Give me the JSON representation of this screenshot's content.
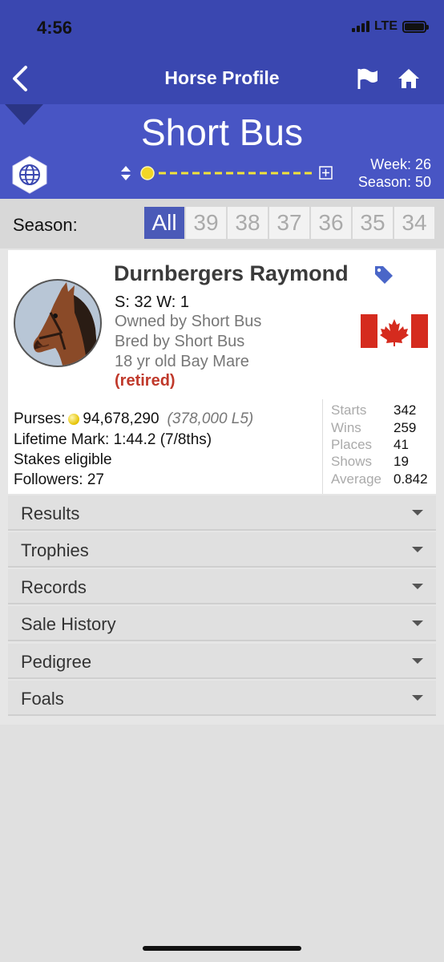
{
  "status": {
    "time": "4:56",
    "network": "LTE"
  },
  "nav": {
    "title": "Horse Profile"
  },
  "header": {
    "stable_name": "Short Bus",
    "week_label": "Week: 26",
    "season_label": "Season: 50"
  },
  "seasons": {
    "label": "Season:",
    "tabs": [
      "All",
      "39",
      "38",
      "37",
      "36",
      "35",
      "34"
    ],
    "selected": "All"
  },
  "horse": {
    "name": "Durnbergers Raymond",
    "sw": "S: 32 W: 1",
    "owned_by": "Owned by Short Bus",
    "bred_by": "Bred by Short Bus",
    "description": "18 yr old Bay Mare",
    "status": "(retired)",
    "country_flag": "canada-flag",
    "purses_label": "Purses:",
    "purses_value": "94,678,290",
    "purses_l5": "(378,000 L5)",
    "lifetime_mark": "Lifetime Mark: 1:44.2 (7/8ths)",
    "stakes": "Stakes eligible",
    "followers": "Followers: 27"
  },
  "stats": [
    {
      "label": "Starts",
      "value": "342"
    },
    {
      "label": "Wins",
      "value": "259"
    },
    {
      "label": "Places",
      "value": "41"
    },
    {
      "label": "Shows",
      "value": "19"
    },
    {
      "label": "Average",
      "value": "0.842"
    }
  ],
  "sections": [
    "Results",
    "Trophies",
    "Records",
    "Sale History",
    "Pedigree",
    "Foals"
  ],
  "colors": {
    "nav": "#3a47b0",
    "header": "#4855c4",
    "accent": "#4a5ab8",
    "retired": "#c0392b"
  }
}
